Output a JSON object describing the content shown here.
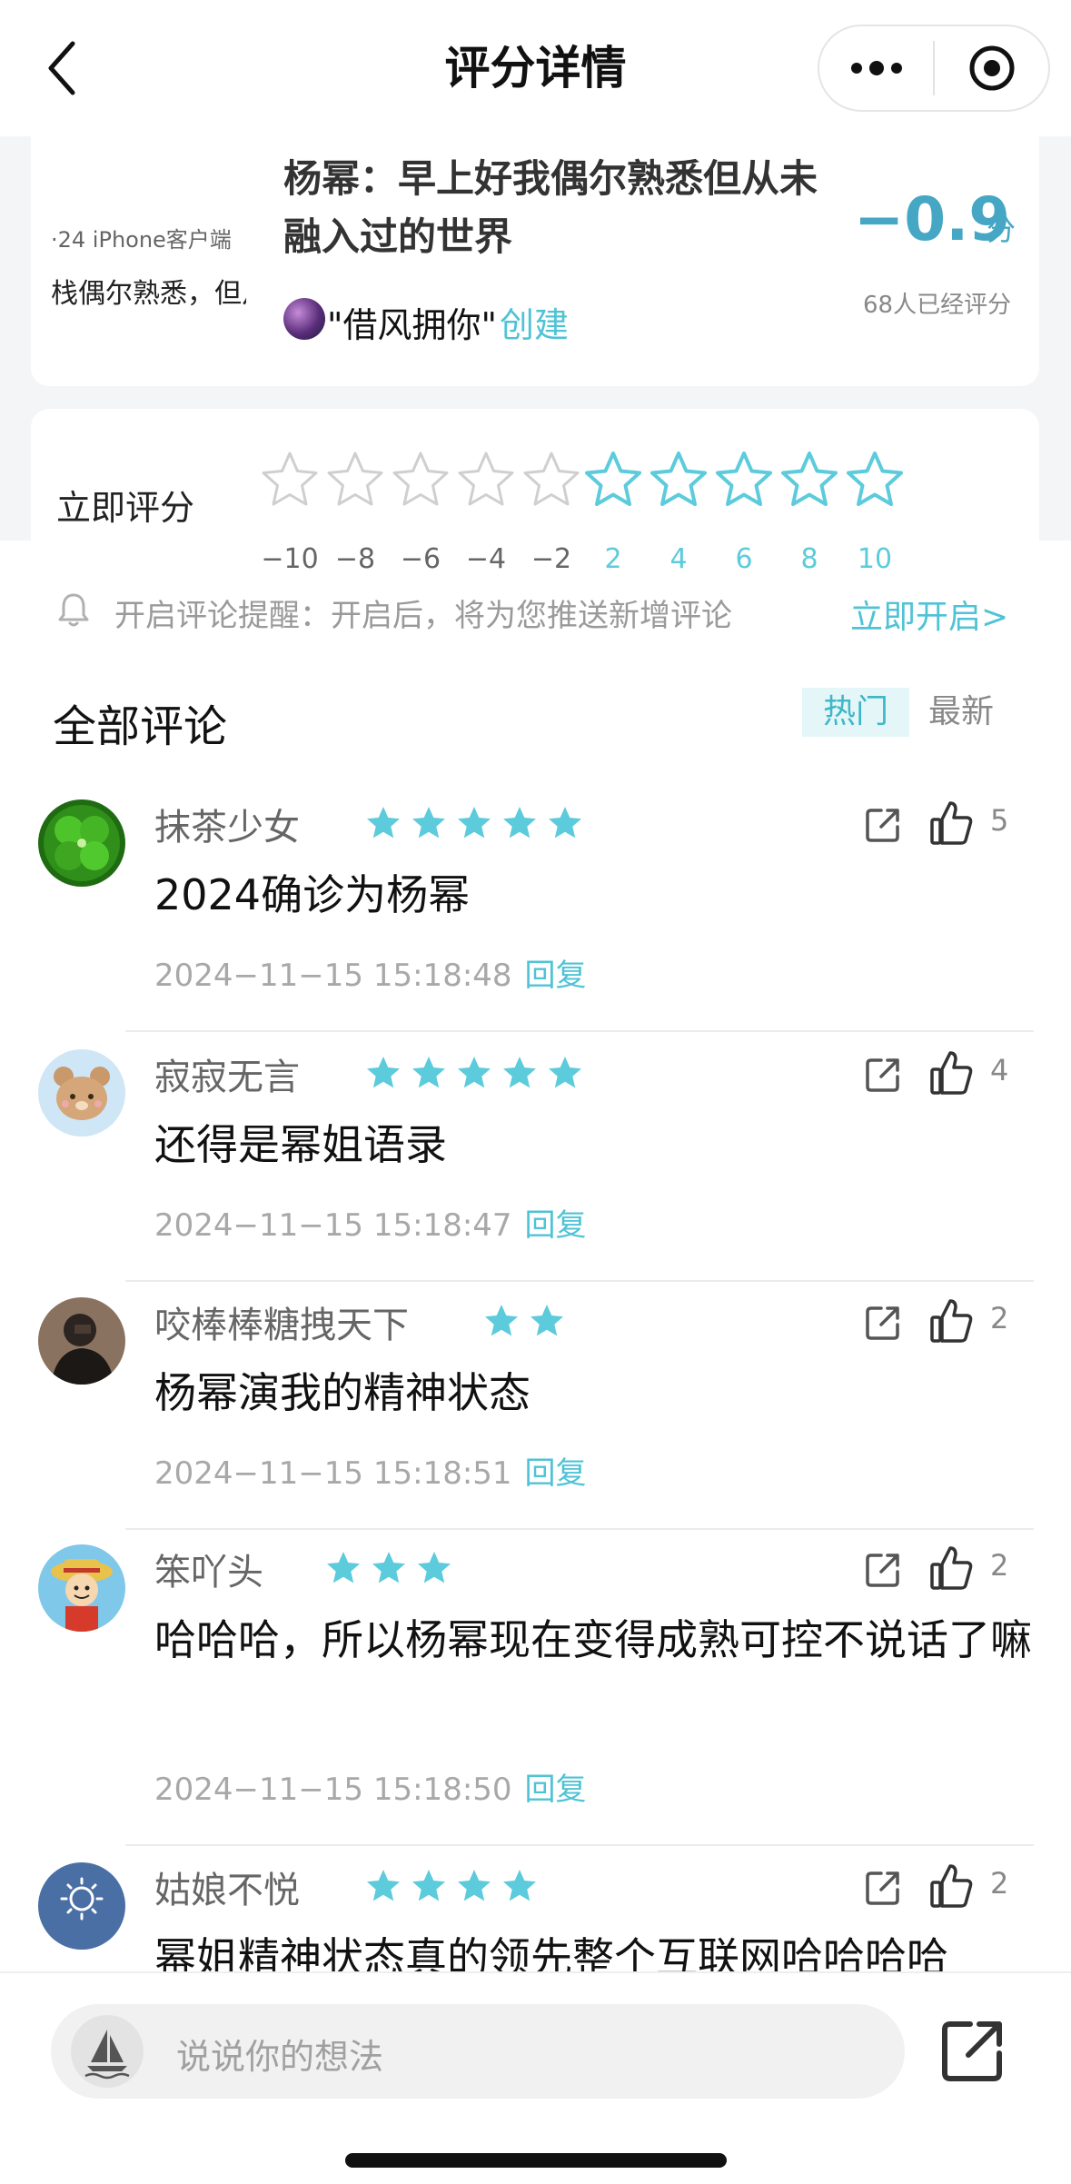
{
  "nav": {
    "title": "评分详情"
  },
  "topic": {
    "thumb_meta": "·24  iPhone客户端",
    "thumb_text": "栈偶尔熟悉，但从",
    "title": "杨幂：早上好我偶尔熟悉但从未融入过的世界",
    "creator_name": "\"借风拥你\"",
    "creator_suffix": "创建",
    "score": "−0.9",
    "score_unit": "分",
    "rating_count": "68人已经评分"
  },
  "rating": {
    "label": "立即评分",
    "ticks": [
      "−10",
      "−8",
      "−6",
      "−4",
      "−2",
      "2",
      "4",
      "6",
      "8",
      "10"
    ],
    "negative_color": "#cfcfcf",
    "positive_color": "#5ccbdb"
  },
  "notice": {
    "text": "开启评论提醒：开启后，将为您推送新增评论",
    "link": "立即开启>"
  },
  "comments_section": {
    "title": "全部评论",
    "tab_hot": "热门",
    "tab_new": "最新"
  },
  "comments": [
    {
      "name": "抹茶少女",
      "stars": 5,
      "text": "2024确诊为杨幂",
      "time": "2024−11−15 15:18:48",
      "reply": "回复",
      "likes": "5",
      "avatar": "clover"
    },
    {
      "name": "寂寂无言",
      "stars": 5,
      "text": "还得是幂姐语录",
      "time": "2024−11−15 15:18:47",
      "reply": "回复",
      "likes": "4",
      "avatar": "bear"
    },
    {
      "name": "咬棒棒糖拽天下",
      "stars": 2,
      "text": "杨幂演我的精神状态",
      "time": "2024−11−15 15:18:51",
      "reply": "回复",
      "likes": "2",
      "avatar": "person"
    },
    {
      "name": "笨吖头",
      "stars": 3,
      "text": "哈哈哈，所以杨幂现在变得成熟可控不说话了嘛",
      "time": "2024−11−15 15:18:50",
      "reply": "回复",
      "likes": "2",
      "avatar": "cartoon"
    },
    {
      "name": "姑娘不悦",
      "stars": 4,
      "text": "幂姐精神状态真的领先整个互联网哈哈哈哈",
      "time": "",
      "reply": "",
      "likes": "2",
      "avatar": "sunshine"
    }
  ],
  "input": {
    "placeholder": "说说你的想法"
  }
}
